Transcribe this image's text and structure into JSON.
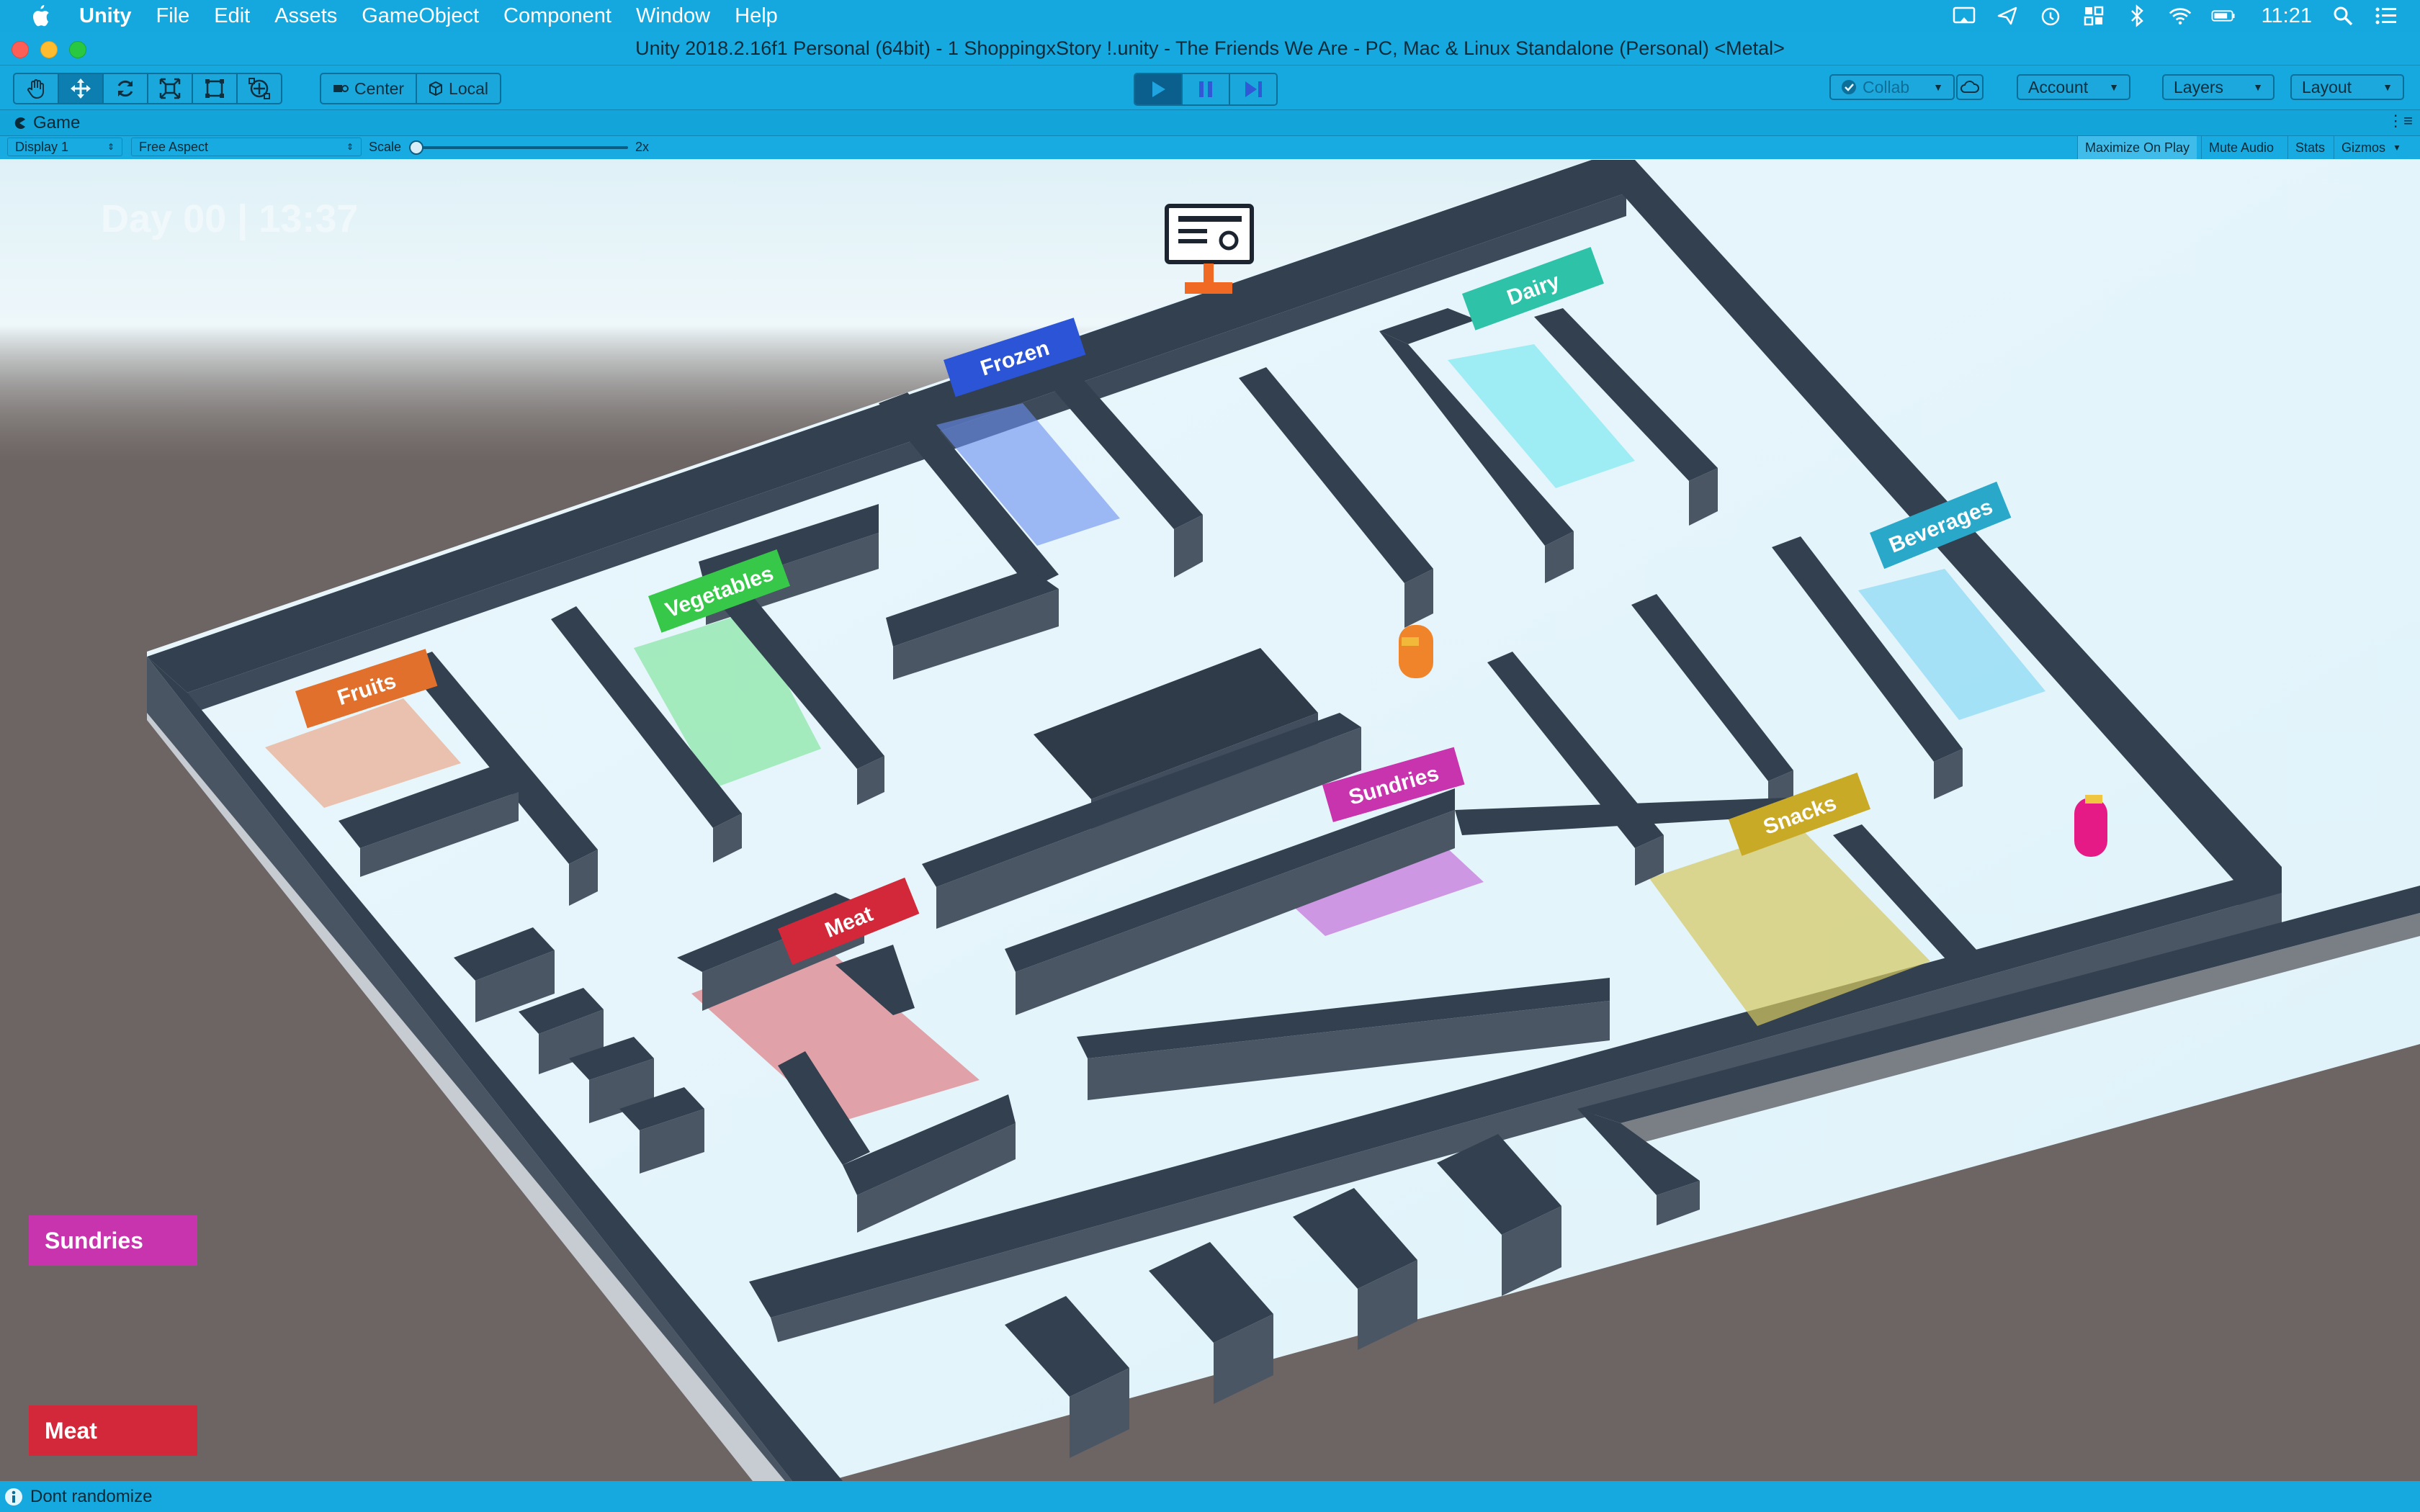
{
  "menubar": {
    "app_name": "Unity",
    "items": [
      "File",
      "Edit",
      "Assets",
      "GameObject",
      "Component",
      "Window",
      "Help"
    ],
    "clock": "11:21"
  },
  "window": {
    "title": "Unity 2018.2.16f1 Personal (64bit) - 1 ShoppingxStory !.unity - The Friends We Are - PC, Mac & Linux Standalone (Personal) <Metal>"
  },
  "toolbar": {
    "pivot_label": "Center",
    "space_label": "Local",
    "collab_label": "Collab",
    "account_label": "Account",
    "layers_label": "Layers",
    "layout_label": "Layout"
  },
  "game_tab": {
    "label": "Game",
    "display": "Display 1",
    "aspect": "Free Aspect",
    "scale_label": "Scale",
    "scale_value": "2x",
    "scale_fraction": 0.0,
    "maximize": "Maximize On Play",
    "mute": "Mute Audio",
    "stats": "Stats",
    "gizmos": "Gizmos"
  },
  "game": {
    "day_time": "Day 00  |  13:37",
    "sections": [
      {
        "name": "Fruits",
        "color": "#e0702c"
      },
      {
        "name": "Vegetables",
        "color": "#37c84a"
      },
      {
        "name": "Frozen",
        "color": "#2c54d6"
      },
      {
        "name": "Dairy",
        "color": "#2ec3a8"
      },
      {
        "name": "Beverages",
        "color": "#2aa8c9"
      },
      {
        "name": "Sundries",
        "color": "#c734ad"
      },
      {
        "name": "Snacks",
        "color": "#c9aa26"
      },
      {
        "name": "Meat",
        "color": "#d2283a"
      }
    ],
    "shopping_list": [
      {
        "name": "Sundries",
        "color": "#c734ad"
      },
      {
        "name": "Meat",
        "color": "#d2283a"
      }
    ]
  },
  "status": {
    "message": "Dont randomize"
  }
}
